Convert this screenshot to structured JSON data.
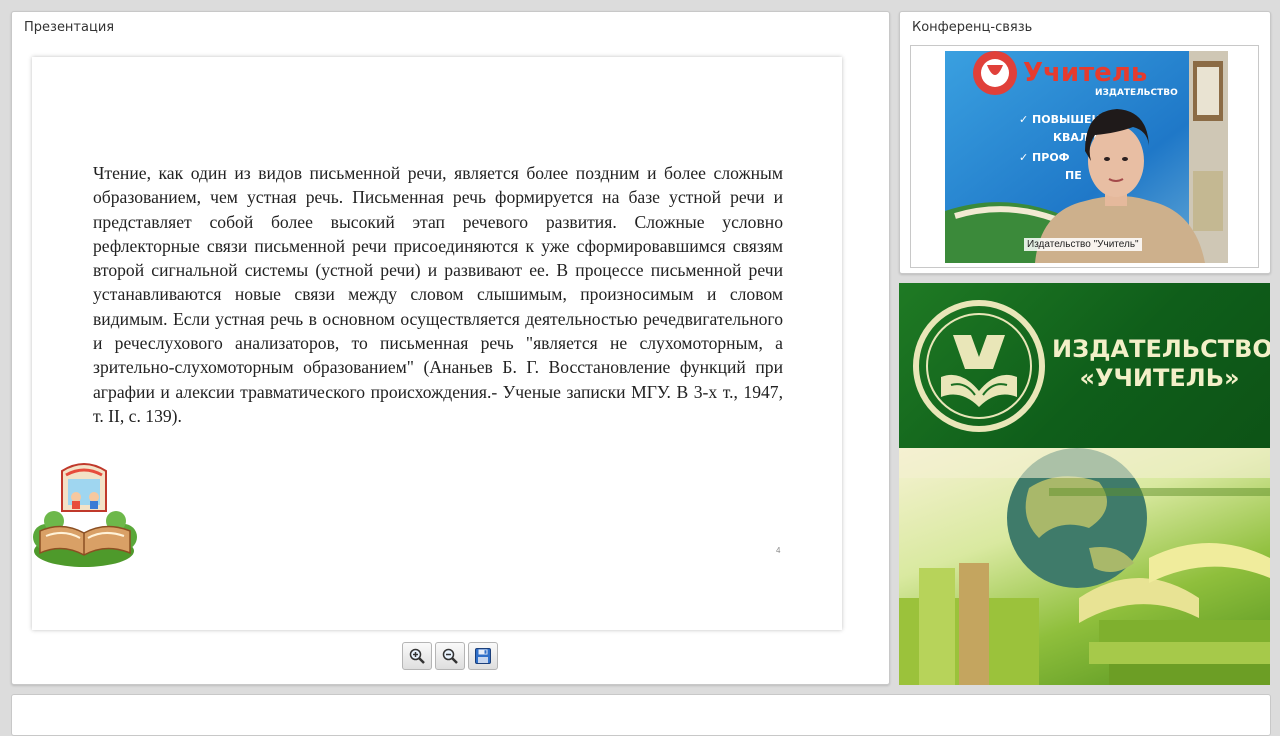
{
  "presentation": {
    "title": "Презентация",
    "slide": {
      "text": "Чтение, как один из видов письменной речи, является более поздним и более сложным образованием, чем устная речь. Письменная речь формируется на базе устной речи и представляет собой более высокий этап речевого развития. Сложные условно рефлекторные связи письменной речи присоединяются к уже сформировавшимся связям второй сигнальной системы (устной речи) и развивают ее. В процессе письменной речи устанавливаются новые связи между словом слышимым, произносимым и словом видимым. Если устная речь в основном осуществляется деятельностью речедвигательного и речеслухового анализаторов, то письменная речь \"является не слухомоторным, а зрительно-слухомоторным образованием\" (Ананьев Б. Г. Восстановление функций при аграфии и алексии травматического происхождения.- Ученые записки МГУ. В 3-х т., 1947, т. II, с. 139).",
      "page_number": "4"
    },
    "toolbar": {
      "zoom_in_icon": "zoom-in-icon",
      "zoom_out_icon": "zoom-out-icon",
      "save_icon": "save-icon"
    }
  },
  "conference": {
    "title": "Конференц-связь",
    "participant_label": "Издательство \"Учитель\""
  },
  "banner": {
    "line1": "ИЗДАТЕЛЬСТВО",
    "line2": "«УЧИТЕЛЬ»"
  },
  "colors": {
    "banner_green": "#1a6e22",
    "banner_text": "#f3f0c8",
    "panel_bg": "#ffffff",
    "page_bg": "#dcdcdc"
  }
}
